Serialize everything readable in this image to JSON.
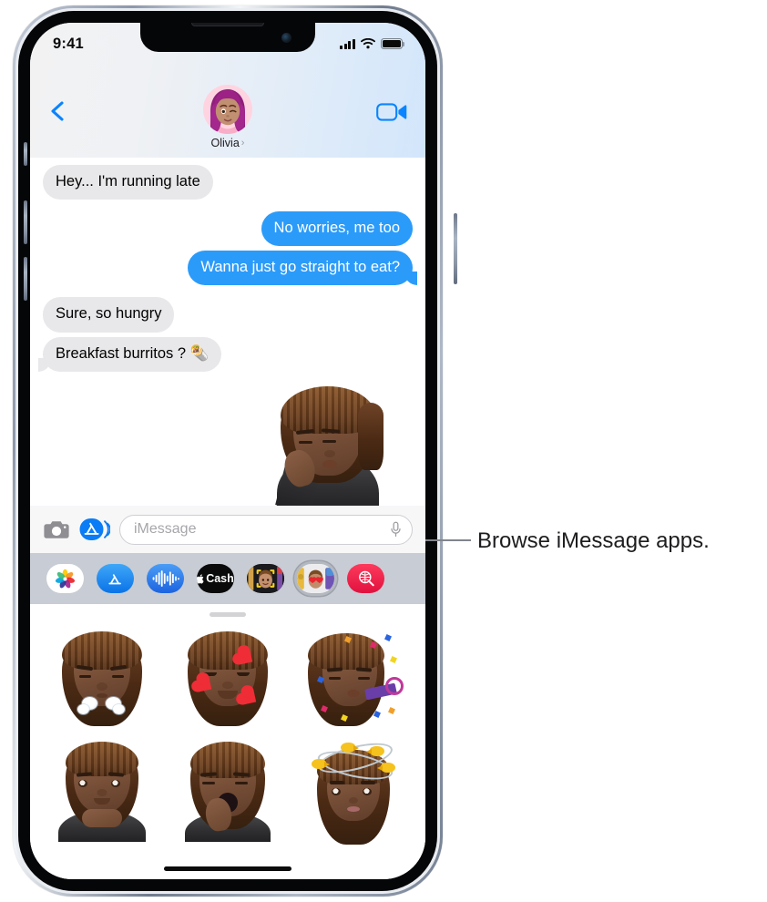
{
  "device": {
    "name": "iphone-13",
    "status_bar": {
      "time": "9:41",
      "cellular_icon": "signal-bars-icon",
      "wifi_icon": "wifi-icon",
      "battery_icon": "battery-full-icon"
    },
    "home_indicator": "home-indicator"
  },
  "nav": {
    "back_icon": "chevron-left-icon",
    "contact_name": "Olivia",
    "contact_chevron": "›",
    "facetime_icon": "video-camera-icon",
    "avatar_name": "olivia-memoji-avatar"
  },
  "conversation": {
    "messages": [
      {
        "id": "msg-1",
        "text": "Hey... I'm running late",
        "side": "incoming",
        "tail": false
      },
      {
        "id": "msg-2",
        "text": "No worries, me too",
        "side": "outgoing",
        "tail": false
      },
      {
        "id": "msg-3",
        "text": "Wanna just go straight to eat?",
        "side": "outgoing",
        "tail": true
      },
      {
        "id": "msg-4",
        "text": "Sure, so hungry",
        "side": "incoming",
        "tail": false
      },
      {
        "id": "msg-5",
        "text": "Breakfast burritos ? 🌯",
        "side": "incoming",
        "tail": true
      }
    ],
    "sticker_message": "memoji-sticker-hand-to-chin"
  },
  "input_bar": {
    "camera_icon": "camera-icon",
    "apps_icon": "app-store-icon",
    "placeholder": "iMessage",
    "dictation_icon": "microphone-icon"
  },
  "app_drawer": {
    "apps": [
      {
        "name": "app-photos",
        "icon": "photos-icon",
        "selected": false
      },
      {
        "name": "app-store",
        "icon": "app-store-icon",
        "selected": false
      },
      {
        "name": "app-audio",
        "icon": "audio-wave-icon",
        "selected": false
      },
      {
        "name": "app-cash",
        "icon": "apple-cash-icon",
        "label": "Cash",
        "selected": false
      },
      {
        "name": "app-memoji",
        "icon": "memoji-icon",
        "selected": false
      },
      {
        "name": "app-stickers",
        "icon": "memoji-stickers-icon",
        "selected": true
      },
      {
        "name": "app-images",
        "icon": "image-search-icon",
        "selected": false
      }
    ]
  },
  "sticker_panel": {
    "grabber": "drag-handle",
    "stickers": [
      {
        "name": "sticker-steam-from-nose",
        "decor": "steam"
      },
      {
        "name": "sticker-smiling-hearts",
        "decor": "hearts"
      },
      {
        "name": "sticker-party-horn",
        "decor": "confetti"
      },
      {
        "name": "sticker-hands-on-chin",
        "decor": "none"
      },
      {
        "name": "sticker-yawning",
        "decor": "none"
      },
      {
        "name": "sticker-birds-overhead",
        "decor": "birds"
      }
    ]
  },
  "callout": {
    "text": "Browse iMessage apps.",
    "target": "app-store"
  },
  "colors": {
    "bubble_outgoing": "#2b9bfa",
    "bubble_incoming": "#e8e8ea",
    "accent_blue": "#0a84ff",
    "drawer_bg": "#c8ccd4",
    "callout_line": "#80858c"
  }
}
